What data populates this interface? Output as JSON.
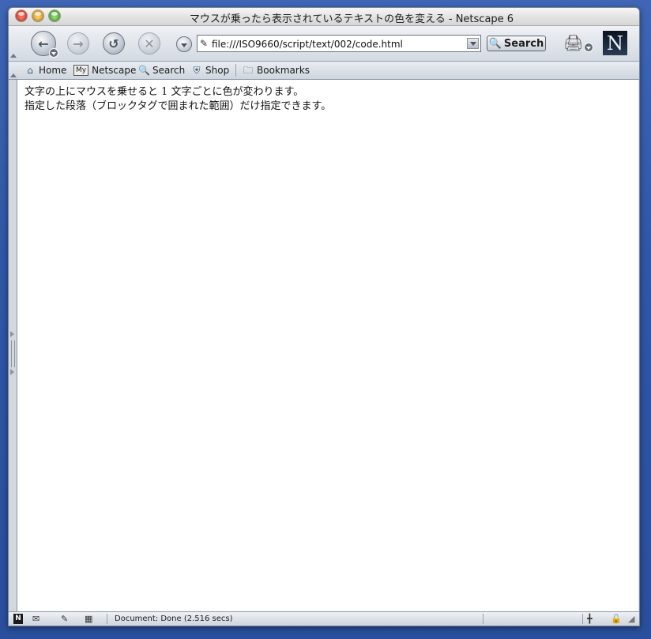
{
  "window": {
    "title": "マウスが乗ったら表示されているテキストの色を変える - Netscape 6"
  },
  "toolbar": {
    "url_value": "file:///ISO9660/script/text/002/code.html",
    "search_label": "Search",
    "logo_letter": "N"
  },
  "personal_toolbar": {
    "items": [
      {
        "label": "Home"
      },
      {
        "label": "Netscape"
      },
      {
        "label": "Search"
      },
      {
        "label": "Shop"
      },
      {
        "label": "Bookmarks"
      }
    ]
  },
  "content": {
    "lines": [
      "文字の上にマウスを乗せると 1 文字ごとに色が変わります。",
      "指定した段落（ブロックタグで囲まれた範囲）だけ指定できます。"
    ]
  },
  "status": {
    "text": "Document: Done (2.516 secs)"
  },
  "colors": {
    "desktop": "#2f57a8",
    "chrome": "#dfe3ea",
    "content_bg": "#ffffff"
  }
}
